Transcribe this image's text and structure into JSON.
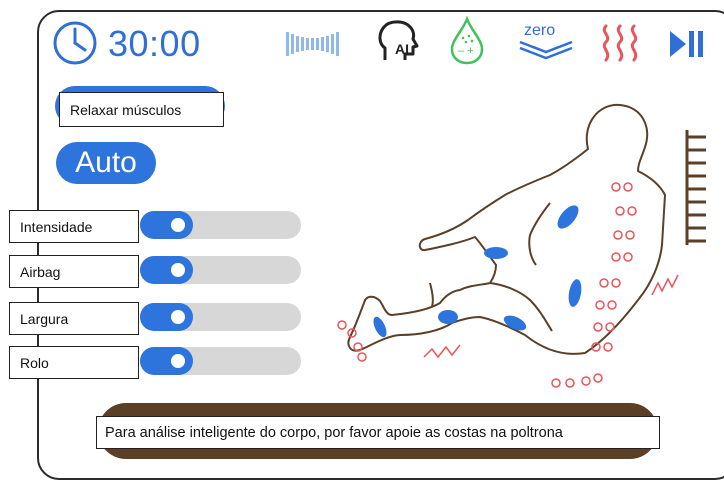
{
  "timer": {
    "value": "30:00"
  },
  "status_icons": [
    {
      "name": "wave-icon"
    },
    {
      "name": "ai-head-icon",
      "label": "AI"
    },
    {
      "name": "water-drop-icon",
      "label": "– +"
    },
    {
      "name": "zero-gravity-icon",
      "label": "zero"
    },
    {
      "name": "heat-icon"
    },
    {
      "name": "play-pause-icon"
    }
  ],
  "mode": {
    "label": "Relaxar músculos",
    "auto_label": "Auto"
  },
  "sliders": [
    {
      "label": "Intensidade",
      "level": 0.33
    },
    {
      "label": "Airbag",
      "level": 0.33
    },
    {
      "label": "Largura",
      "level": 0.33
    },
    {
      "label": "Rolo",
      "level": 0.33
    }
  ],
  "message": {
    "text": "Para análise inteligente do corpo, por favor apoie as costas na poltrona"
  },
  "colors": {
    "accent": "#2d74dd",
    "bar": "#5b3f27",
    "heat": "#e8555a",
    "ai_green": "#3fc25a",
    "outline": "#5b3f27"
  }
}
